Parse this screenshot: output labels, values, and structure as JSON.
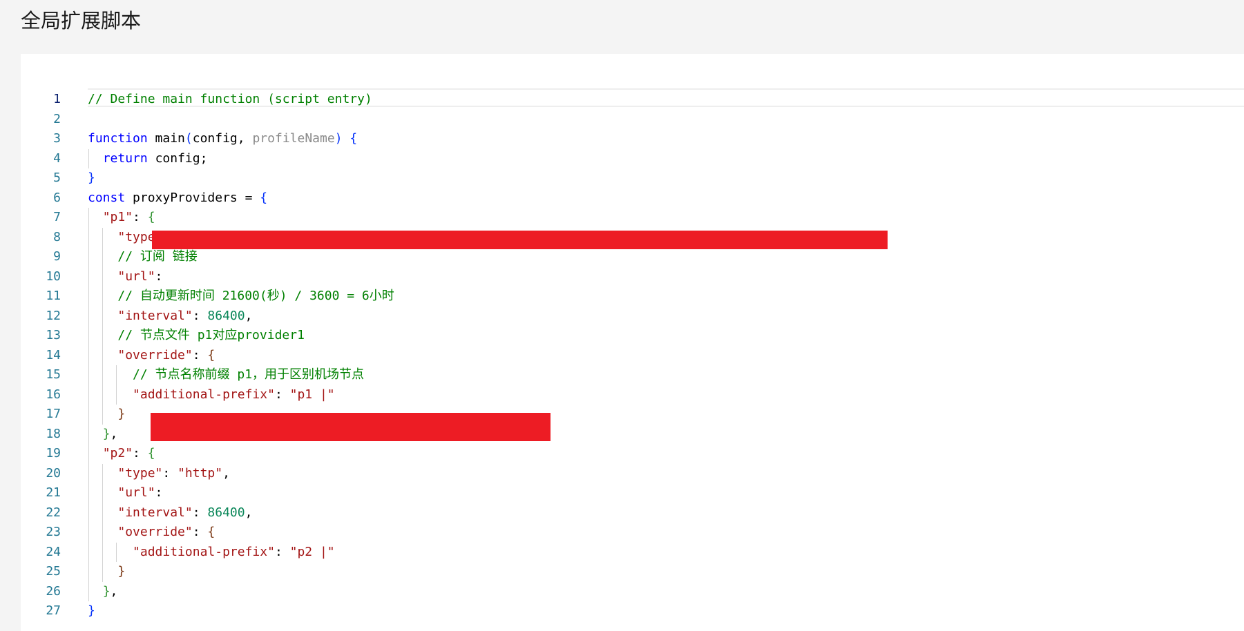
{
  "page": {
    "title": "全局扩展脚本"
  },
  "colors": {
    "background": "#f4f4f4",
    "editor_background": "#ffffff",
    "line_number": "#237893",
    "comment": "#008000",
    "keyword": "#0000ff",
    "string": "#a31515",
    "number": "#098658",
    "redaction": "#ed1c24"
  },
  "editor": {
    "active_line": 1,
    "lines": [
      {
        "n": "1",
        "t": "// Define main function (script entry)"
      },
      {
        "n": "2",
        "t": ""
      },
      {
        "n": "3",
        "t": "function main(config, profileName) {",
        "hint": "profileName"
      },
      {
        "n": "4",
        "t": "  return config;"
      },
      {
        "n": "5",
        "t": "}"
      },
      {
        "n": "6",
        "t": "const proxyProviders = {"
      },
      {
        "n": "7",
        "t": "  \"p1\": {"
      },
      {
        "n": "8",
        "t": "    \"type\": \"http\","
      },
      {
        "n": "9",
        "t": "    // 订阅 链接"
      },
      {
        "n": "10",
        "t": "    \"url\": ",
        "redacted": true
      },
      {
        "n": "11",
        "t": "    // 自动更新时间 21600(秒) / 3600 = 6小时"
      },
      {
        "n": "12",
        "t": "    \"interval\": 86400,"
      },
      {
        "n": "13",
        "t": "    // 节点文件 p1对应provider1"
      },
      {
        "n": "14",
        "t": "    \"override\": {"
      },
      {
        "n": "15",
        "t": "      // 节点名称前缀 p1，用于区别机场节点"
      },
      {
        "n": "16",
        "t": "      \"additional-prefix\": \"p1 |\""
      },
      {
        "n": "17",
        "t": "    }"
      },
      {
        "n": "18",
        "t": "  },"
      },
      {
        "n": "19",
        "t": "  \"p2\": {"
      },
      {
        "n": "20",
        "t": "    \"type\": \"http\","
      },
      {
        "n": "21",
        "t": "    \"url\": ",
        "redacted": true
      },
      {
        "n": "22",
        "t": "    \"interval\": 86400,"
      },
      {
        "n": "23",
        "t": "    \"override\": {"
      },
      {
        "n": "24",
        "t": "      \"additional-prefix\": \"p2 |\""
      },
      {
        "n": "25",
        "t": "    }"
      },
      {
        "n": "26",
        "t": "  },"
      },
      {
        "n": "27",
        "t": "}"
      }
    ]
  }
}
